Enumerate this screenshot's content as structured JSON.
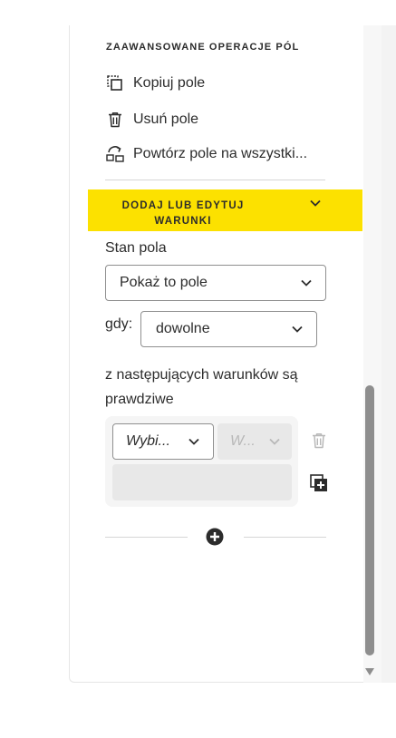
{
  "advanced": {
    "title": "ZAAWANSOWANE OPERACJE PÓL",
    "copy_label": "Kopiuj pole",
    "delete_label": "Usuń pole",
    "repeat_label": "Powtórz pole na wszystki..."
  },
  "conditions": {
    "banner_title": "DODAJ LUB EDYTUJ WARUNKI",
    "field_state_label": "Stan pola",
    "field_state_value": "Pokaż to pole",
    "when_label": "gdy:",
    "when_value": "dowolne",
    "description": "z następujących warunków są prawdziwe",
    "rule_field_value": "Wybi...",
    "rule_operator_value": "W..."
  },
  "icons": {
    "copy": "copy-field-icon",
    "delete": "trash-icon",
    "repeat": "repeat-icon",
    "chevron": "chevron-down-icon",
    "add_rule": "add-rule-icon",
    "add_condition": "plus-circle-icon"
  },
  "colors": {
    "banner": "#fce100",
    "text": "#2c2c2c",
    "disabled": "#b8b8b8"
  }
}
